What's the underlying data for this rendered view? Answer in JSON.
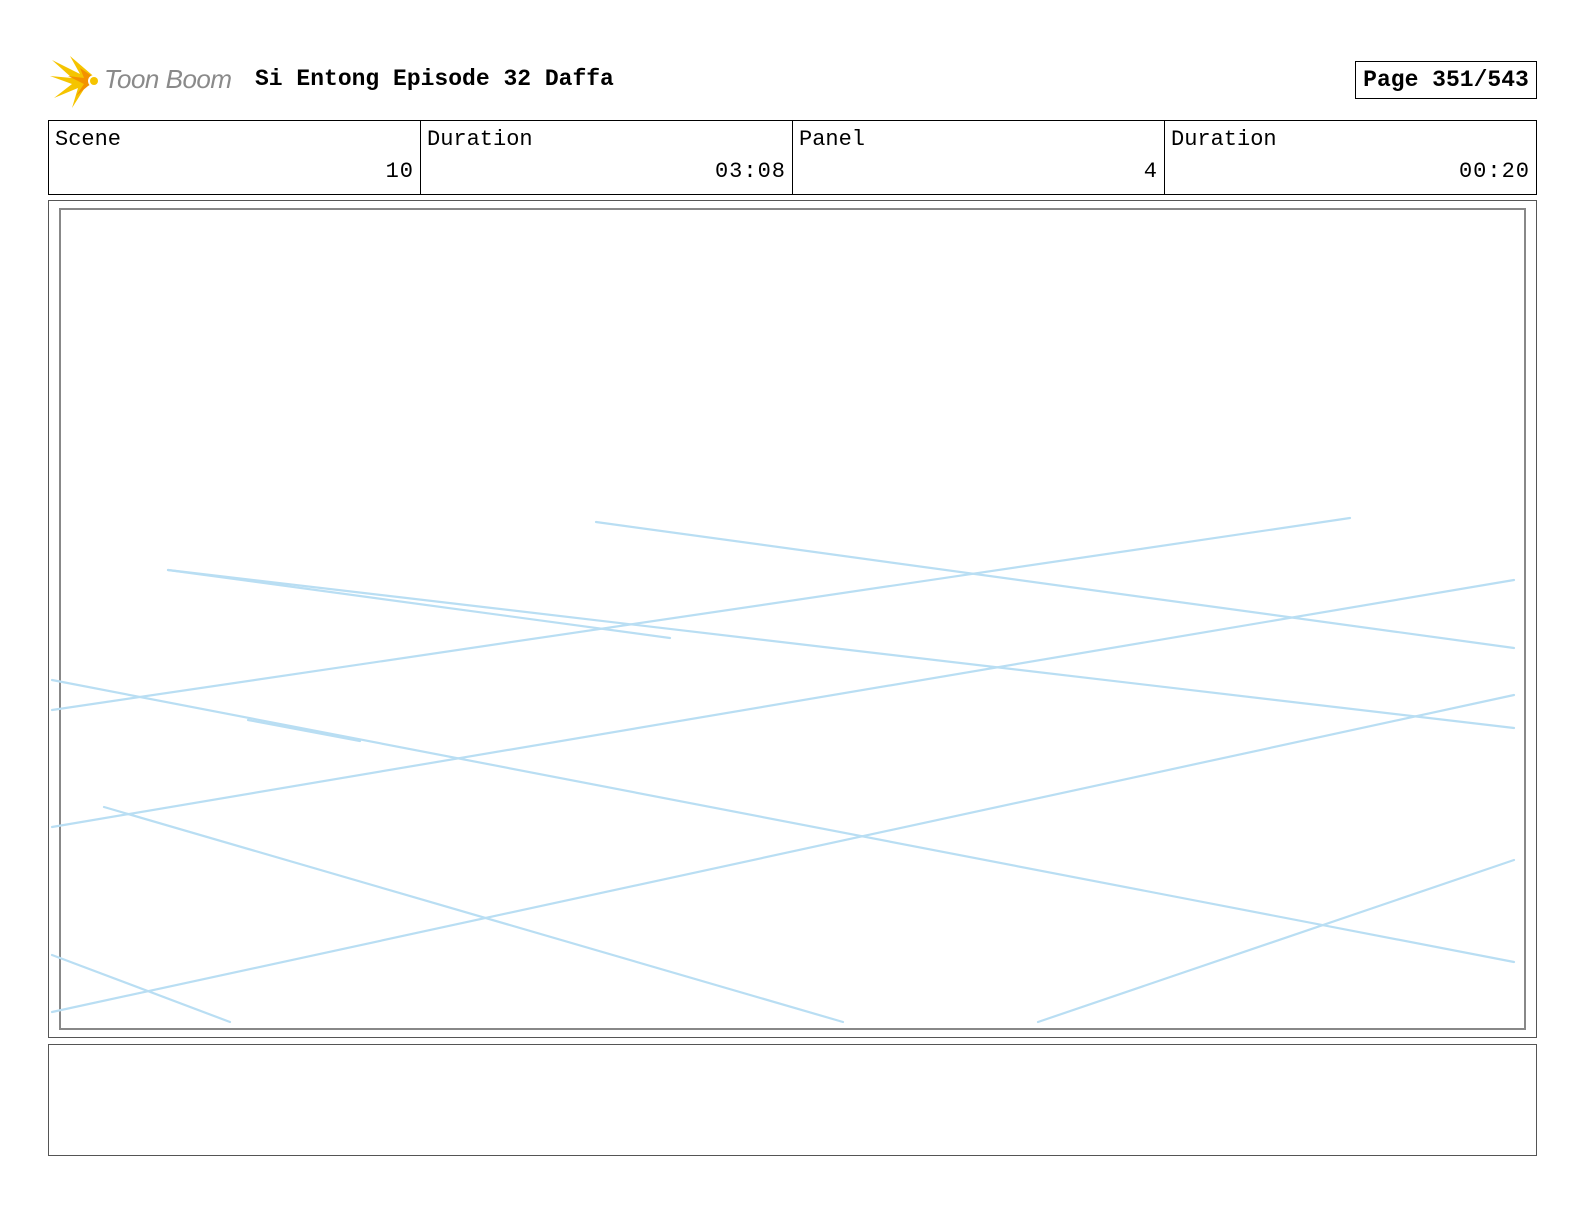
{
  "header": {
    "logo_text": "Toon Boom",
    "title": "Si Entong Episode 32 Daffa",
    "page_label": "Page 351/543"
  },
  "info": {
    "scene_label": "Scene",
    "scene_value": "10",
    "scene_duration_label": "Duration",
    "scene_duration_value": "03:08",
    "panel_label": "Panel",
    "panel_value": "4",
    "panel_duration_label": "Duration",
    "panel_duration_value": "00:20"
  },
  "colors": {
    "logo_yellow": "#f5c400",
    "logo_orange": "#f39200",
    "sketch_line": "#b9def3"
  },
  "notes": {
    "text": ""
  }
}
